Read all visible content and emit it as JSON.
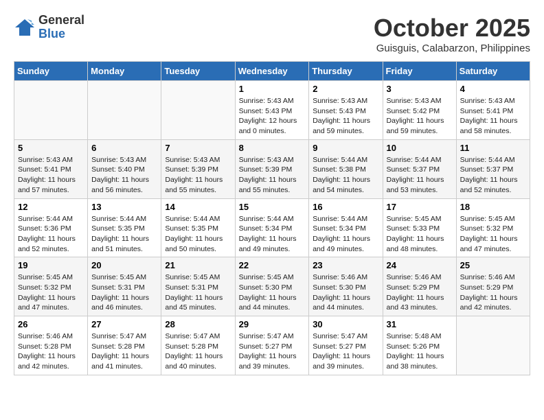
{
  "header": {
    "logo_general": "General",
    "logo_blue": "Blue",
    "month_title": "October 2025",
    "location": "Guisguis, Calabarzon, Philippines"
  },
  "days_of_week": [
    "Sunday",
    "Monday",
    "Tuesday",
    "Wednesday",
    "Thursday",
    "Friday",
    "Saturday"
  ],
  "weeks": [
    [
      {
        "day": "",
        "info": ""
      },
      {
        "day": "",
        "info": ""
      },
      {
        "day": "",
        "info": ""
      },
      {
        "day": "1",
        "info": "Sunrise: 5:43 AM\nSunset: 5:43 PM\nDaylight: 12 hours\nand 0 minutes."
      },
      {
        "day": "2",
        "info": "Sunrise: 5:43 AM\nSunset: 5:43 PM\nDaylight: 11 hours\nand 59 minutes."
      },
      {
        "day": "3",
        "info": "Sunrise: 5:43 AM\nSunset: 5:42 PM\nDaylight: 11 hours\nand 59 minutes."
      },
      {
        "day": "4",
        "info": "Sunrise: 5:43 AM\nSunset: 5:41 PM\nDaylight: 11 hours\nand 58 minutes."
      }
    ],
    [
      {
        "day": "5",
        "info": "Sunrise: 5:43 AM\nSunset: 5:41 PM\nDaylight: 11 hours\nand 57 minutes."
      },
      {
        "day": "6",
        "info": "Sunrise: 5:43 AM\nSunset: 5:40 PM\nDaylight: 11 hours\nand 56 minutes."
      },
      {
        "day": "7",
        "info": "Sunrise: 5:43 AM\nSunset: 5:39 PM\nDaylight: 11 hours\nand 55 minutes."
      },
      {
        "day": "8",
        "info": "Sunrise: 5:43 AM\nSunset: 5:39 PM\nDaylight: 11 hours\nand 55 minutes."
      },
      {
        "day": "9",
        "info": "Sunrise: 5:44 AM\nSunset: 5:38 PM\nDaylight: 11 hours\nand 54 minutes."
      },
      {
        "day": "10",
        "info": "Sunrise: 5:44 AM\nSunset: 5:37 PM\nDaylight: 11 hours\nand 53 minutes."
      },
      {
        "day": "11",
        "info": "Sunrise: 5:44 AM\nSunset: 5:37 PM\nDaylight: 11 hours\nand 52 minutes."
      }
    ],
    [
      {
        "day": "12",
        "info": "Sunrise: 5:44 AM\nSunset: 5:36 PM\nDaylight: 11 hours\nand 52 minutes."
      },
      {
        "day": "13",
        "info": "Sunrise: 5:44 AM\nSunset: 5:35 PM\nDaylight: 11 hours\nand 51 minutes."
      },
      {
        "day": "14",
        "info": "Sunrise: 5:44 AM\nSunset: 5:35 PM\nDaylight: 11 hours\nand 50 minutes."
      },
      {
        "day": "15",
        "info": "Sunrise: 5:44 AM\nSunset: 5:34 PM\nDaylight: 11 hours\nand 49 minutes."
      },
      {
        "day": "16",
        "info": "Sunrise: 5:44 AM\nSunset: 5:34 PM\nDaylight: 11 hours\nand 49 minutes."
      },
      {
        "day": "17",
        "info": "Sunrise: 5:45 AM\nSunset: 5:33 PM\nDaylight: 11 hours\nand 48 minutes."
      },
      {
        "day": "18",
        "info": "Sunrise: 5:45 AM\nSunset: 5:32 PM\nDaylight: 11 hours\nand 47 minutes."
      }
    ],
    [
      {
        "day": "19",
        "info": "Sunrise: 5:45 AM\nSunset: 5:32 PM\nDaylight: 11 hours\nand 47 minutes."
      },
      {
        "day": "20",
        "info": "Sunrise: 5:45 AM\nSunset: 5:31 PM\nDaylight: 11 hours\nand 46 minutes."
      },
      {
        "day": "21",
        "info": "Sunrise: 5:45 AM\nSunset: 5:31 PM\nDaylight: 11 hours\nand 45 minutes."
      },
      {
        "day": "22",
        "info": "Sunrise: 5:45 AM\nSunset: 5:30 PM\nDaylight: 11 hours\nand 44 minutes."
      },
      {
        "day": "23",
        "info": "Sunrise: 5:46 AM\nSunset: 5:30 PM\nDaylight: 11 hours\nand 44 minutes."
      },
      {
        "day": "24",
        "info": "Sunrise: 5:46 AM\nSunset: 5:29 PM\nDaylight: 11 hours\nand 43 minutes."
      },
      {
        "day": "25",
        "info": "Sunrise: 5:46 AM\nSunset: 5:29 PM\nDaylight: 11 hours\nand 42 minutes."
      }
    ],
    [
      {
        "day": "26",
        "info": "Sunrise: 5:46 AM\nSunset: 5:28 PM\nDaylight: 11 hours\nand 42 minutes."
      },
      {
        "day": "27",
        "info": "Sunrise: 5:47 AM\nSunset: 5:28 PM\nDaylight: 11 hours\nand 41 minutes."
      },
      {
        "day": "28",
        "info": "Sunrise: 5:47 AM\nSunset: 5:28 PM\nDaylight: 11 hours\nand 40 minutes."
      },
      {
        "day": "29",
        "info": "Sunrise: 5:47 AM\nSunset: 5:27 PM\nDaylight: 11 hours\nand 39 minutes."
      },
      {
        "day": "30",
        "info": "Sunrise: 5:47 AM\nSunset: 5:27 PM\nDaylight: 11 hours\nand 39 minutes."
      },
      {
        "day": "31",
        "info": "Sunrise: 5:48 AM\nSunset: 5:26 PM\nDaylight: 11 hours\nand 38 minutes."
      },
      {
        "day": "",
        "info": ""
      }
    ]
  ]
}
